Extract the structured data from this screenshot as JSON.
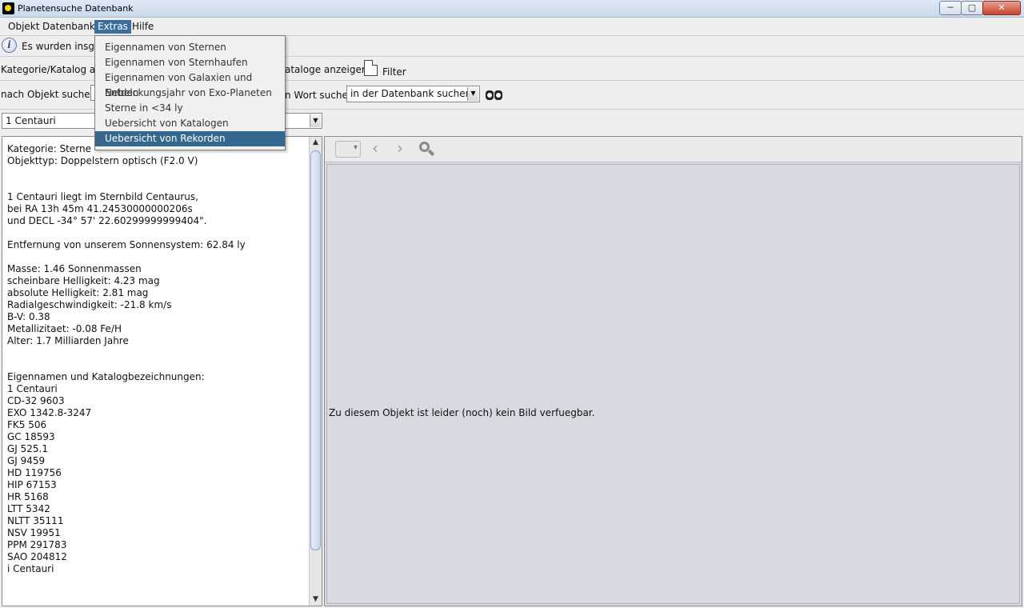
{
  "window": {
    "title": "Planetensuche Datenbank",
    "minimize_glyph": "─",
    "maximize_glyph": "▢",
    "close_glyph": "✕"
  },
  "menubar": {
    "items": [
      "Objekt",
      "Datenbank",
      "Extras",
      "Hilfe"
    ],
    "active": "Extras"
  },
  "extras_menu": {
    "items": [
      "Eigennamen von Sternen",
      "Eigennamen von Sternhaufen",
      "Eigennamen von Galaxien und Nebeln",
      "Entdeckungsjahr von Exo-Planeten",
      "Sterne in <34 ly",
      "Uebersicht von Katalogen",
      "Uebersicht von Rekorden"
    ],
    "selected": "Uebersicht von Rekorden"
  },
  "info_bar": {
    "text": "Es wurden insge"
  },
  "category_row": {
    "label": "Kategorie/Katalog aus",
    "catalog_text": "ataloge anzeigen",
    "filter_label": "Filter"
  },
  "search_row": {
    "label": "nach Objekt suchen:",
    "word_label": "n Wort suchen",
    "scope_value": "in der Datenbank suchen"
  },
  "object_select": {
    "value": "1 Centauri"
  },
  "details": {
    "lines": [
      "Kategorie: Sterne",
      "Objekttyp: Doppelstern optisch (F2.0 V)",
      "",
      "",
      "1 Centauri liegt im Sternbild Centaurus,",
      "bei RA 13h 45m 41.24530000000206s",
      "und DECL -34° 57' 22.60299999999404\".",
      "",
      "Entfernung von unserem Sonnensystem: 62.84 ly",
      "",
      "Masse: 1.46 Sonnenmassen",
      "scheinbare Helligkeit: 4.23 mag",
      "absolute Helligkeit: 2.81 mag",
      "Radialgeschwindigkeit: -21.8 km/s",
      "B-V: 0.38",
      "Metallizitaet: -0.08 Fe/H",
      "Alter: 1.7 Milliarden Jahre",
      "",
      "",
      "Eigennamen und Katalogbezeichnungen:",
      "1 Centauri",
      "CD-32 9603",
      "EXO 1342.8-3247",
      "FK5 506",
      "GC 18593",
      "GJ 525.1",
      "GJ 9459",
      "HD 119756",
      "HIP 67153",
      "HR 5168",
      "LTT 5342",
      "NLTT 35111",
      "NSV 19951",
      "PPM 291783",
      "SAO 204812",
      "i Centauri"
    ]
  },
  "image_panel": {
    "prev_glyph": "‹",
    "next_glyph": "›",
    "no_image_text": "Zu diesem Objekt ist leider (noch) kein Bild verfuegbar."
  },
  "scrollbar": {
    "up_glyph": "▲",
    "down_glyph": "▼"
  },
  "combo_arrow_glyph": "▼",
  "info_icon_glyph": "i"
}
